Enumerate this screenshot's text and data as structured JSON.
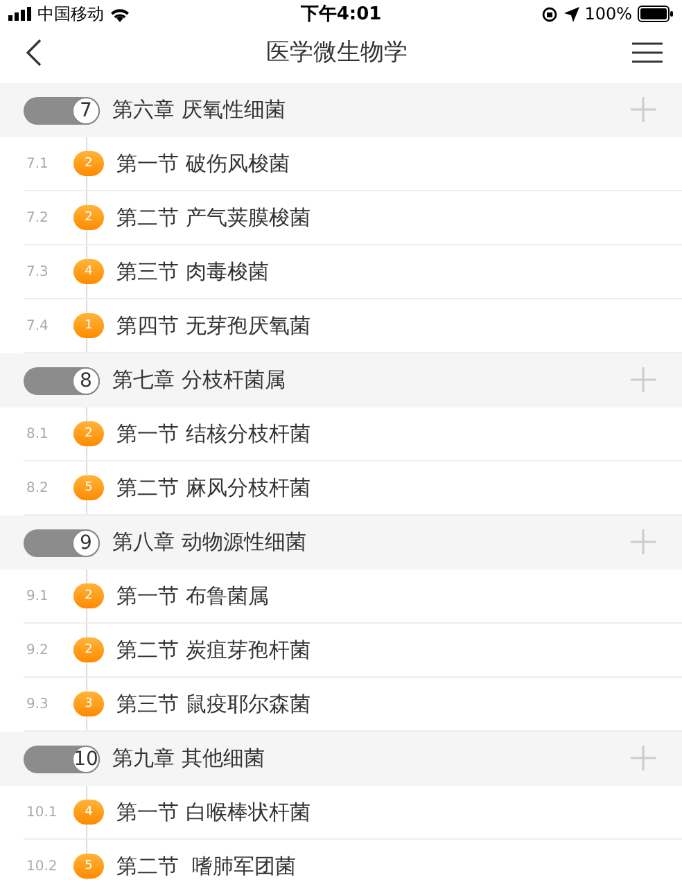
{
  "status_bar": {
    "carrier": "中国移动",
    "time": "下午4:01",
    "battery": "100%"
  },
  "nav": {
    "title": "医学微生物学"
  },
  "chapters": [
    {
      "number": "7",
      "title": "第六章 厌氧性细菌",
      "sections": [
        {
          "number": "7.1",
          "badge": "2",
          "title": "第一节 破伤风梭菌"
        },
        {
          "number": "7.2",
          "badge": "2",
          "title": "第二节 产气荚膜梭菌"
        },
        {
          "number": "7.3",
          "badge": "4",
          "title": "第三节 肉毒梭菌"
        },
        {
          "number": "7.4",
          "badge": "1",
          "title": "第四节 无芽孢厌氧菌"
        }
      ]
    },
    {
      "number": "8",
      "title": "第七章 分枝杆菌属",
      "sections": [
        {
          "number": "8.1",
          "badge": "2",
          "title": "第一节 结核分枝杆菌"
        },
        {
          "number": "8.2",
          "badge": "5",
          "title": "第二节 麻风分枝杆菌"
        }
      ]
    },
    {
      "number": "9",
      "title": "第八章 动物源性细菌",
      "sections": [
        {
          "number": "9.1",
          "badge": "2",
          "title": "第一节 布鲁菌属"
        },
        {
          "number": "9.2",
          "badge": "2",
          "title": "第二节 炭疽芽孢杆菌"
        },
        {
          "number": "9.3",
          "badge": "3",
          "title": "第三节 鼠疫耶尔森菌"
        }
      ]
    },
    {
      "number": "10",
      "title": "第九章 其他细菌",
      "sections": [
        {
          "number": "10.1",
          "badge": "4",
          "title": "第一节 白喉棒状杆菌"
        },
        {
          "number": "10.2",
          "badge": "5",
          "title": "第二节  嗜肺军团菌"
        }
      ]
    }
  ]
}
